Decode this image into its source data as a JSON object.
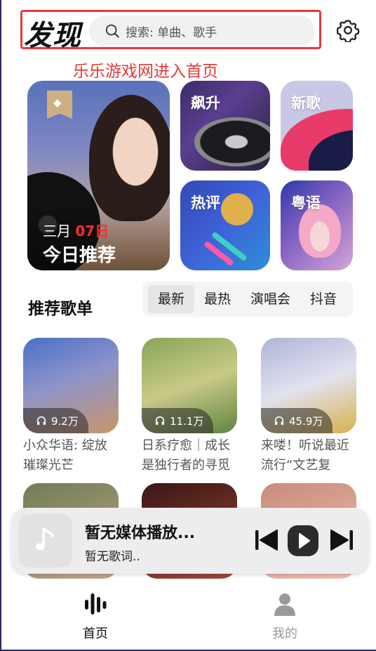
{
  "header": {
    "title": "发现",
    "search_placeholder": "搜索: 单曲、歌手",
    "promo_text": "乐乐游戏网进入首页"
  },
  "featured": {
    "main": {
      "month": "三月",
      "day": "07日",
      "label": "今日推荐"
    },
    "cards": [
      {
        "label": "飙升"
      },
      {
        "label": "新歌"
      },
      {
        "label": "热评"
      },
      {
        "label": "粤语"
      }
    ]
  },
  "playlists": {
    "section_title": "推荐歌单",
    "tabs": [
      "最新",
      "最热",
      "演唱会",
      "抖音"
    ],
    "active_tab": "最新",
    "items": [
      {
        "count": "9.2万",
        "title": "小众华语: 绽放璀璨光芒"
      },
      {
        "count": "11.1万",
        "title": "日系疗愈｜成长是独行者的寻觅"
      },
      {
        "count": "45.9万",
        "title": "来喽！听说最近流行“文艺复兴”?"
      }
    ]
  },
  "player": {
    "title": "暂无媒体播放...",
    "lyric": "暂无歌词.."
  },
  "nav": {
    "home": "首页",
    "me": "我的"
  },
  "colors": {
    "accent_red": "#e53935",
    "highlight_red": "#ff2d2d",
    "tab_active_bg": "#e6e6e9"
  }
}
